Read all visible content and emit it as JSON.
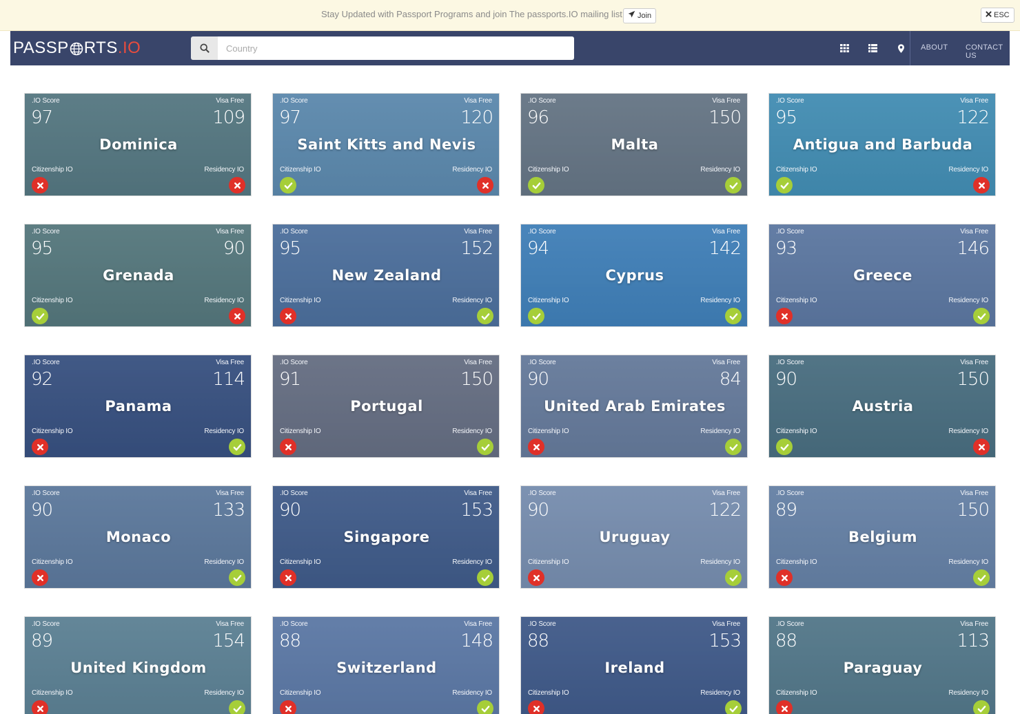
{
  "notice": {
    "text": "Stay Updated with Passport Programs and join The passports.IO mailing list.",
    "join_label": "Join",
    "esc_label": "ESC"
  },
  "header": {
    "logo_main": "PASSP",
    "logo_mid": "RTS",
    "logo_io": ".IO",
    "search_placeholder": "Country",
    "about": "ABOUT",
    "contact": "CONTACT US"
  },
  "labels": {
    "io_score": ".IO Score",
    "visa_free": "Visa Free",
    "citizenship": "Citizenship IO",
    "residency": "Residency IO"
  },
  "colors": {
    "navbar": "#39456a",
    "accent_red": "#e84c3d",
    "yes": "#a6ce39",
    "no": "#e03028"
  },
  "countries": [
    {
      "name": "Dominica",
      "score": "97",
      "visa": "109",
      "citizenship": false,
      "residency": false,
      "bg": "#6e8a6a"
    },
    {
      "name": "Saint Kitts and Nevis",
      "score": "97",
      "visa": "120",
      "citizenship": true,
      "residency": false,
      "bg": "#7aa8b5"
    },
    {
      "name": "Malta",
      "score": "96",
      "visa": "150",
      "citizenship": true,
      "residency": true,
      "bg": "#8a8670"
    },
    {
      "name": "Antigua and Barbuda",
      "score": "95",
      "visa": "122",
      "citizenship": true,
      "residency": false,
      "bg": "#4fb0c0"
    },
    {
      "name": "Grenada",
      "score": "95",
      "visa": "90",
      "citizenship": true,
      "residency": false,
      "bg": "#6e8a62"
    },
    {
      "name": "New Zealand",
      "score": "95",
      "visa": "152",
      "citizenship": false,
      "residency": true,
      "bg": "#5f7c98"
    },
    {
      "name": "Cyprus",
      "score": "94",
      "visa": "142",
      "citizenship": true,
      "residency": true,
      "bg": "#4a98c8"
    },
    {
      "name": "Greece",
      "score": "93",
      "visa": "146",
      "citizenship": false,
      "residency": true,
      "bg": "#7a8aa0"
    },
    {
      "name": "Panama",
      "score": "92",
      "visa": "114",
      "citizenship": false,
      "residency": true,
      "bg": "#3c4868"
    },
    {
      "name": "Portugal",
      "score": "91",
      "visa": "150",
      "citizenship": false,
      "residency": true,
      "bg": "#8a7a6c"
    },
    {
      "name": "United Arab Emirates",
      "score": "90",
      "visa": "84",
      "citizenship": false,
      "residency": true,
      "bg": "#8a8f96"
    },
    {
      "name": "Austria",
      "score": "90",
      "visa": "150",
      "citizenship": true,
      "residency": false,
      "bg": "#5a7a68"
    },
    {
      "name": "Monaco",
      "score": "90",
      "visa": "133",
      "citizenship": false,
      "residency": true,
      "bg": "#7a8c98"
    },
    {
      "name": "Singapore",
      "score": "90",
      "visa": "153",
      "citizenship": false,
      "residency": true,
      "bg": "#4a5a78"
    },
    {
      "name": "Uruguay",
      "score": "90",
      "visa": "122",
      "citizenship": false,
      "residency": true,
      "bg": "#a8b0b8"
    },
    {
      "name": "Belgium",
      "score": "89",
      "visa": "150",
      "citizenship": false,
      "residency": true,
      "bg": "#8a9aa8"
    },
    {
      "name": "United Kingdom",
      "score": "89",
      "visa": "154",
      "citizenship": false,
      "residency": true,
      "bg": "#7a9a8a"
    },
    {
      "name": "Switzerland",
      "score": "88",
      "visa": "148",
      "citizenship": false,
      "residency": true,
      "bg": "#7a8ca8"
    },
    {
      "name": "Ireland",
      "score": "88",
      "visa": "153",
      "citizenship": false,
      "residency": true,
      "bg": "#4a5878"
    },
    {
      "name": "Paraguay",
      "score": "88",
      "visa": "113",
      "citizenship": false,
      "residency": true,
      "bg": "#6a8a78"
    }
  ]
}
